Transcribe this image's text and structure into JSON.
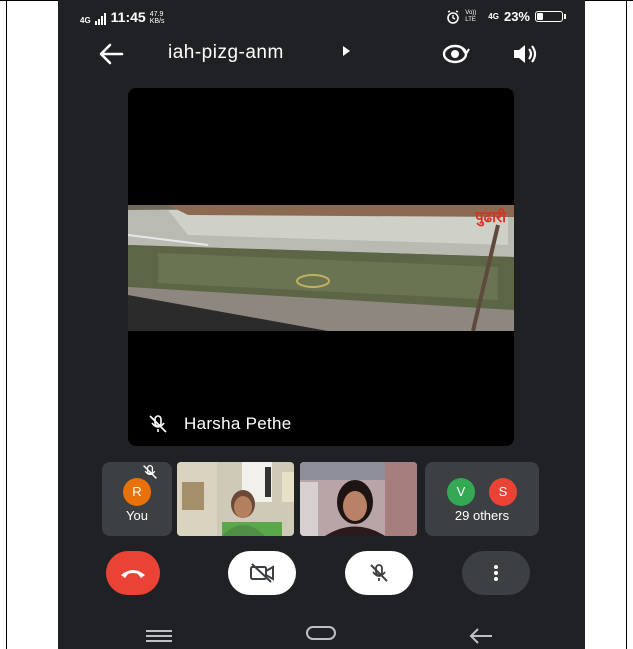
{
  "status": {
    "network_type": "4G",
    "time": "11:45",
    "speed_value": "47.9",
    "speed_unit": "KB/s",
    "volte": "Vo)) LTE",
    "mobile_data": "4G",
    "battery": "23%",
    "battery_level": 0.23
  },
  "meeting": {
    "code": "iah-pizg-anm"
  },
  "main_video": {
    "participant_name": "Harsha Pethe",
    "watermark": "पुढारी"
  },
  "participants": {
    "self_initial": "R",
    "self_label": "You",
    "others_initials": [
      "V",
      "S"
    ],
    "others_label": "29 others"
  },
  "colors": {
    "background": "#202124",
    "tile": "#3c4043",
    "end_call": "#ea4335",
    "avatar_r": "#e8710a",
    "avatar_v": "#34a853",
    "avatar_s": "#ea4335"
  },
  "icons": {
    "back": "arrow-left-icon",
    "switch_camera": "camera-switch-icon",
    "speaker": "speaker-icon",
    "mic_muted": "mic-off-icon",
    "end_call": "phone-hangup-icon",
    "camera_off": "video-off-icon",
    "more": "more-vertical-icon"
  }
}
